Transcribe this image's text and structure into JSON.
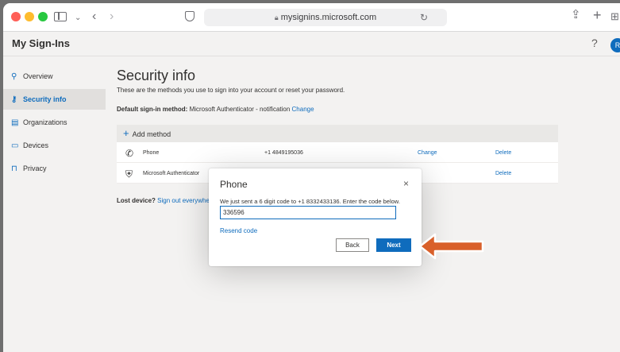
{
  "browser": {
    "url": "mysignins.microsoft.com"
  },
  "app": {
    "title": "My Sign-Ins",
    "help": "?",
    "avatar_initial": "R"
  },
  "sidebar": {
    "items": [
      {
        "label": "Overview",
        "active": false
      },
      {
        "label": "Security info",
        "active": true
      },
      {
        "label": "Organizations",
        "active": false
      },
      {
        "label": "Devices",
        "active": false
      },
      {
        "label": "Privacy",
        "active": false
      }
    ]
  },
  "main": {
    "title": "Security info",
    "description": "These are the methods you use to sign into your account or reset your password.",
    "default_method_label": "Default sign-in method:",
    "default_method_value": "Microsoft Authenticator - notification",
    "default_method_change": "Change",
    "add_method": "Add method",
    "methods": [
      {
        "name": "Phone",
        "detail": "+1 4849195036",
        "change": "Change",
        "delete": "Delete"
      },
      {
        "name": "Microsoft Authenticator",
        "detail": "",
        "change": "",
        "delete": "Delete"
      }
    ],
    "lost_device_label": "Lost device?",
    "lost_device_link": "Sign out everywhere"
  },
  "modal": {
    "title": "Phone",
    "close": "×",
    "message": "We just sent a 6 digit code to +1 8332433136. Enter the code below.",
    "code_value": "336596",
    "resend": "Resend code",
    "back": "Back",
    "next": "Next"
  },
  "colors": {
    "accent": "#0f6cbd",
    "annotation_arrow": "#d9602a"
  }
}
